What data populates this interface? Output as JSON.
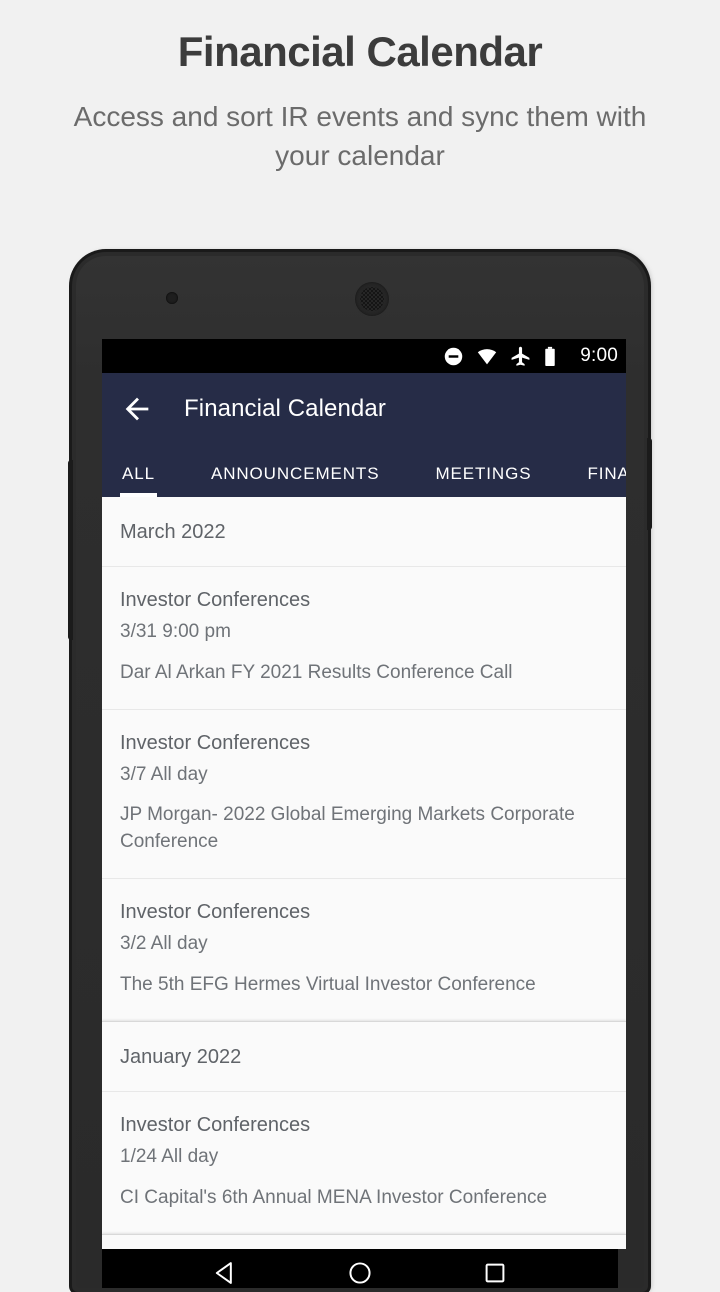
{
  "promo": {
    "title": "Financial Calendar",
    "subtitle": "Access and sort IR events and sync them with your calendar"
  },
  "colors": {
    "page_background": "#f1f1f1",
    "appbar": "#262c47",
    "list_background": "#fafafa",
    "text_primary": "#5f6368",
    "text_secondary": "#6f7378",
    "accent_indicator": "#ffffff",
    "promo_title": "#3c3c3c",
    "promo_subtitle": "#6b6b6b"
  },
  "statusbar": {
    "time": "9:00",
    "icons": [
      "do-not-disturb-icon",
      "wifi-icon",
      "airplane-mode-icon",
      "battery-icon"
    ]
  },
  "appbar": {
    "back_icon": "back-arrow-icon",
    "title": "Financial Calendar",
    "tabs": [
      {
        "label": "ALL",
        "active": true
      },
      {
        "label": "ANNOUNCEMENTS",
        "active": false
      },
      {
        "label": "MEETINGS",
        "active": false
      },
      {
        "label": "FINAN",
        "active": false
      }
    ]
  },
  "calendar": {
    "groups": [
      {
        "month": "March 2022",
        "events": [
          {
            "type": "Investor Conferences",
            "date": "3/31 9:00 pm",
            "description": "Dar Al Arkan FY 2021 Results Conference Call"
          },
          {
            "type": "Investor Conferences",
            "date": "3/7 All day",
            "description": "JP Morgan- 2022 Global Emerging Markets Corporate Conference"
          },
          {
            "type": "Investor Conferences",
            "date": "3/2 All day",
            "description": "The 5th EFG Hermes Virtual Investor Conference"
          }
        ]
      },
      {
        "month": "January 2022",
        "events": [
          {
            "type": "Investor Conferences",
            "date": "1/24 All day",
            "description": "CI Capital's 6th Annual MENA Investor Conference"
          }
        ]
      }
    ]
  },
  "navbar": {
    "buttons": [
      {
        "name": "back-nav-icon"
      },
      {
        "name": "home-nav-icon"
      },
      {
        "name": "recents-nav-icon"
      }
    ]
  }
}
